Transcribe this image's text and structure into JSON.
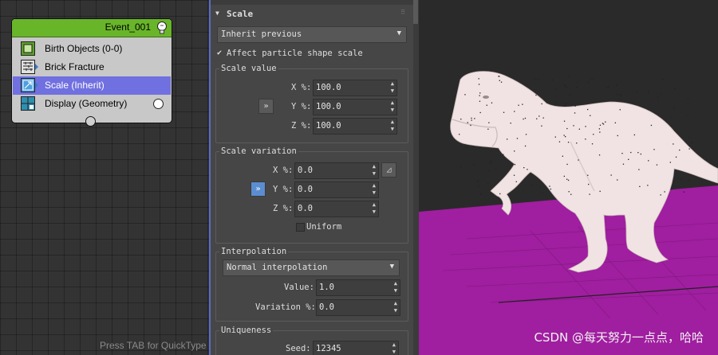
{
  "event_node": {
    "title": "Event_001",
    "operators": [
      {
        "label": "Birth Objects (0-0)",
        "icon": "birth-objects-icon"
      },
      {
        "label": "Brick Fracture",
        "icon": "brick-fracture-icon"
      },
      {
        "label": "Scale (Inherit)",
        "icon": "scale-icon",
        "selected": true
      },
      {
        "label": "Display (Geometry)",
        "icon": "display-icon"
      }
    ]
  },
  "node_editor": {
    "hint": "Press TAB for QuickType"
  },
  "scale_panel": {
    "title": "Scale",
    "type_dropdown": "Inherit previous",
    "affect_shape_label": "Affect particle shape scale",
    "scale_value": {
      "label": "Scale value",
      "link_button": "»",
      "x_label": "X %:",
      "x": "100.0",
      "y_label": "Y %:",
      "y": "100.0",
      "z_label": "Z %:",
      "z": "100.0"
    },
    "scale_variation": {
      "label": "Scale variation",
      "link_button": "»",
      "x_label": "X %:",
      "x": "0.0",
      "y_label": "Y %:",
      "y": "0.0",
      "z_label": "Z %:",
      "z": "0.0",
      "uniform_label": "Uniform"
    },
    "interpolation": {
      "label": "Interpolation",
      "dropdown": "Normal interpolation",
      "value_label": "Value:",
      "value": "1.0",
      "variation_label": "Variation %:",
      "variation": "0.0"
    },
    "uniqueness": {
      "label": "Uniqueness",
      "seed_label": "Seed:",
      "seed": "12345"
    }
  },
  "viewport": {
    "watermark": "CSDN @每天努力一点点，哈哈",
    "colors": {
      "background": "#2a2a2a",
      "ground": "#a01ea0",
      "model": "#f1e3e3"
    }
  },
  "colors": {
    "node_header": "#69b52a",
    "selection": "#7070e0",
    "accent_blue": "#5b8ed0"
  }
}
